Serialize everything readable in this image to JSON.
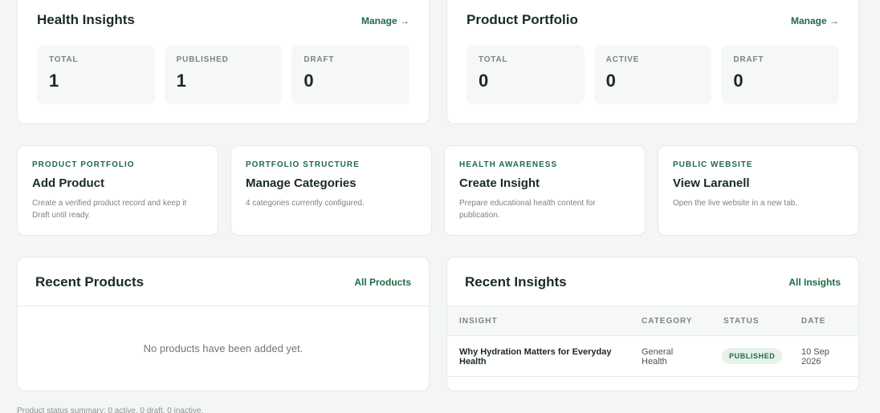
{
  "health_insights": {
    "title": "Health Insights",
    "manage_label": "Manage →",
    "stats": [
      {
        "label": "TOTAL",
        "value": "1"
      },
      {
        "label": "PUBLISHED",
        "value": "1"
      },
      {
        "label": "DRAFT",
        "value": "0"
      }
    ]
  },
  "product_portfolio": {
    "title": "Product Portfolio",
    "manage_label": "Manage →",
    "stats": [
      {
        "label": "TOTAL",
        "value": "0"
      },
      {
        "label": "ACTIVE",
        "value": "0"
      },
      {
        "label": "DRAFT",
        "value": "0"
      }
    ]
  },
  "actions": [
    {
      "eyebrow": "PRODUCT PORTFOLIO",
      "title": "Add Product",
      "description": "Create a verified product record and keep it Draft until ready."
    },
    {
      "eyebrow": "PORTFOLIO STRUCTURE",
      "title": "Manage Categories",
      "description": "4 categories currently configured."
    },
    {
      "eyebrow": "HEALTH AWARENESS",
      "title": "Create Insight",
      "description": "Prepare educational health content for publication."
    },
    {
      "eyebrow": "PUBLIC WEBSITE",
      "title": "View Laranell",
      "description": "Open the live website in a new tab."
    }
  ],
  "recent_products": {
    "title": "Recent Products",
    "link_label": "All Products",
    "empty_message": "No products have been added yet."
  },
  "recent_insights": {
    "title": "Recent Insights",
    "link_label": "All Insights",
    "columns": {
      "insight": "INSIGHT",
      "category": "CATEGORY",
      "status": "STATUS",
      "date": "DATE"
    },
    "rows": [
      {
        "insight": "Why Hydration Matters for Everyday Health",
        "category": "General Health",
        "status": "PUBLISHED",
        "date": "10 Sep 2026"
      }
    ]
  },
  "footer": {
    "summary": "Product status summary: 0 active, 0 draft, 0 inactive."
  },
  "colors": {
    "accent": "#1f6b45",
    "badge_bg": "#e6f2ea",
    "page_bg": "#f4f6f5"
  }
}
